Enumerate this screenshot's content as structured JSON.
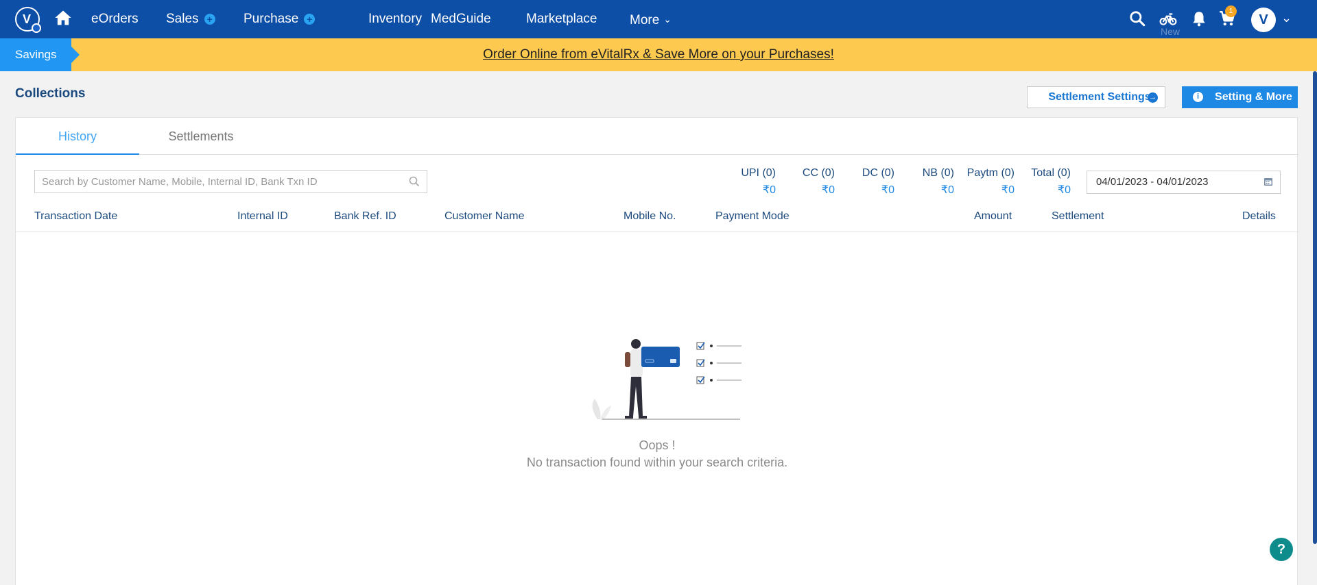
{
  "nav": {
    "logo_letter": "V",
    "items": [
      {
        "label": "eOrders"
      },
      {
        "label": "Sales"
      },
      {
        "label": "Purchase"
      },
      {
        "label": "Inventory"
      },
      {
        "label": "MedGuide"
      },
      {
        "label": "Marketplace"
      },
      {
        "label": "More"
      }
    ],
    "plus_glyph": "+",
    "chevron_glyph": "⌄",
    "icons": [
      "home-icon",
      "search-icon",
      "bike-icon",
      "bell-icon",
      "cart-icon"
    ],
    "new_label": "New",
    "cart_count": "1",
    "avatar_letter": "V"
  },
  "banner": {
    "tag": "Savings",
    "message": "Order Online from eVitalRx & Save More on your Purchases!",
    "color": "#fdc94f"
  },
  "page": {
    "title": "Collections",
    "settlement_settings_label": "Settlement Settings",
    "setting_more_label": "Setting & More"
  },
  "tabs": [
    {
      "label": "History",
      "active": true
    },
    {
      "label": "Settlements",
      "active": false
    }
  ],
  "search": {
    "placeholder": "Search by Customer Name, Mobile, Internal ID, Bank Txn ID"
  },
  "summary": [
    {
      "label": "UPI (0)",
      "value": "₹0"
    },
    {
      "label": "CC (0)",
      "value": "₹0"
    },
    {
      "label": "DC (0)",
      "value": "₹0"
    },
    {
      "label": "NB (0)",
      "value": "₹0"
    },
    {
      "label": "Paytm (0)",
      "value": "₹0"
    },
    {
      "label": "Total (0)",
      "value": "₹0"
    }
  ],
  "date_range": "04/01/2023 - 04/01/2023",
  "columns": [
    "Transaction Date",
    "Internal ID",
    "Bank Ref. ID",
    "Customer Name",
    "Mobile No.",
    "Payment Mode",
    "Amount",
    "Settlement",
    "Details"
  ],
  "empty": {
    "title": "Oops !",
    "message": "No transaction found within your search criteria."
  },
  "help_glyph": "?",
  "colors": {
    "nav_bg": "#0d4ea6",
    "accent": "#1e88e5",
    "help": "#0e8c8c"
  }
}
